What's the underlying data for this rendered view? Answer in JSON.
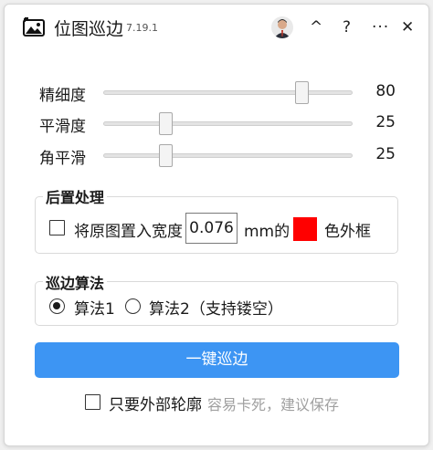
{
  "app": {
    "title": "位图巡边",
    "version": "7.19.1"
  },
  "titlebar": {
    "collapse_icon": "^",
    "help_icon": "?",
    "more_icon": "···",
    "close_icon": "✕"
  },
  "sliders": [
    {
      "label": "精细度",
      "value": "80",
      "level": 0.8
    },
    {
      "label": "平滑度",
      "value": "25",
      "level": 0.25
    },
    {
      "label": "角平滑",
      "value": "25",
      "level": 0.25
    }
  ],
  "post_process": {
    "title": "后置处理",
    "checkbox_label": "将原图置入宽度",
    "width_value": "0.076",
    "unit_label": "mm的",
    "color": "#ff0000",
    "suffix_label": "色外框",
    "checked": false
  },
  "algorithm": {
    "title": "巡边算法",
    "options": [
      {
        "label": "算法1",
        "selected": true
      },
      {
        "label": "算法2（支持镂空）",
        "selected": false
      }
    ]
  },
  "action": {
    "button_label": "一键巡边"
  },
  "outer_only": {
    "label": "只要外部轮廓",
    "hint": "容易卡死，建议保存",
    "checked": false
  }
}
